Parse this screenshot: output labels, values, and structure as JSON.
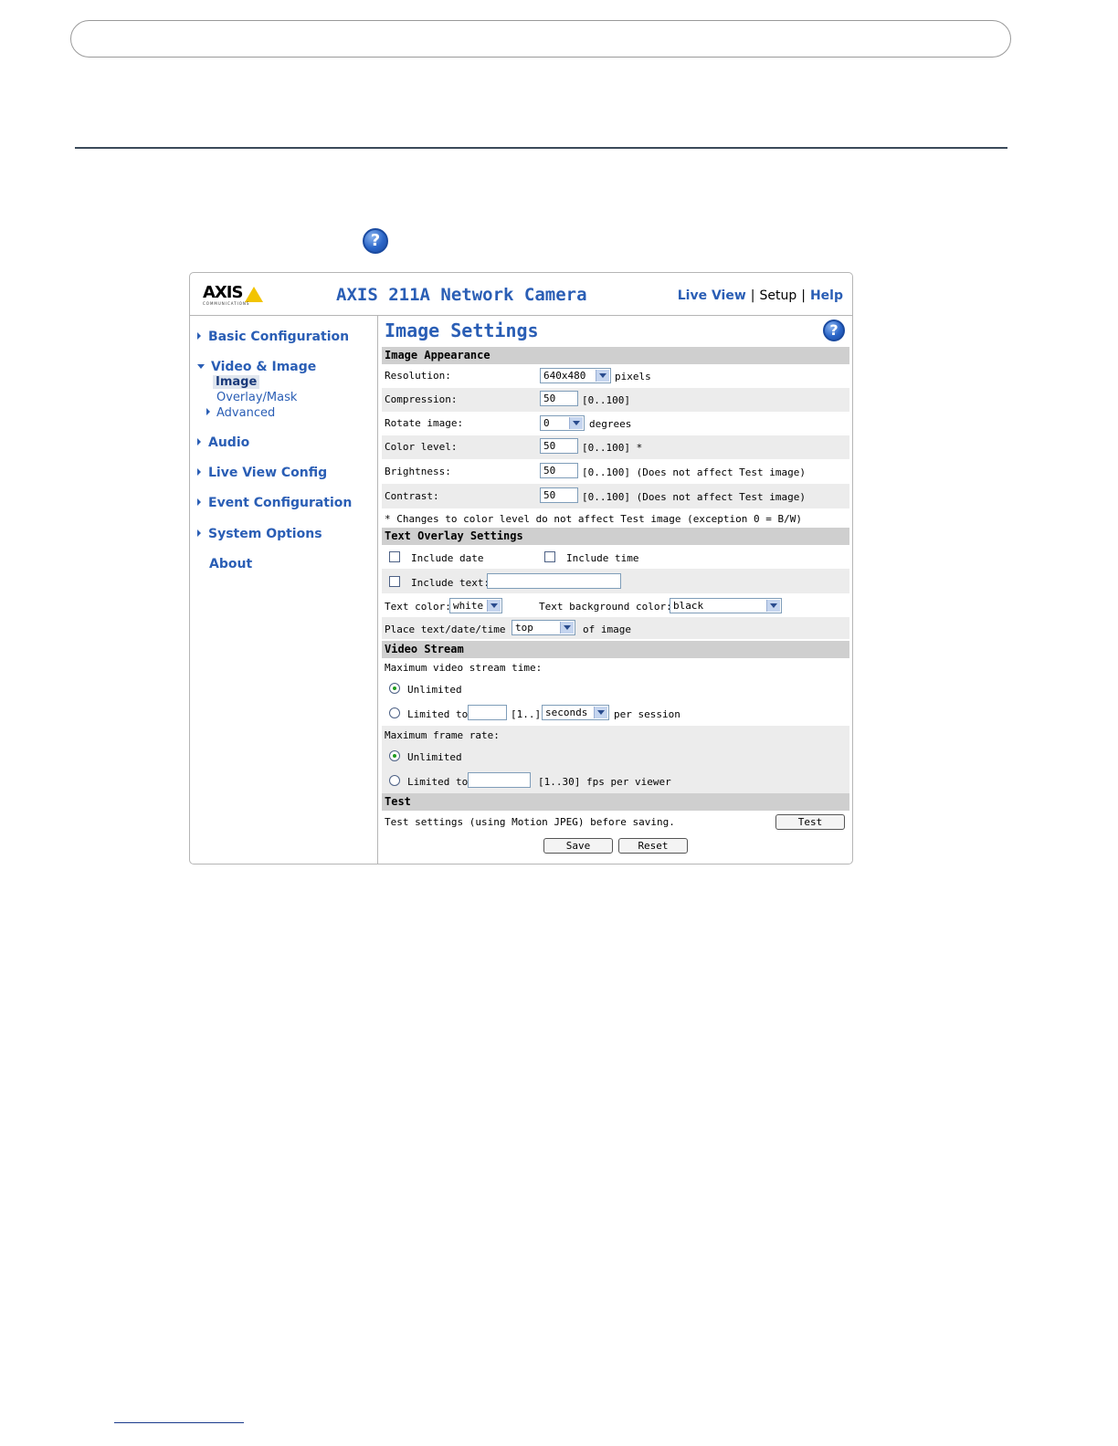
{
  "header": {
    "logo_text": "AXIS",
    "logo_subtext": "COMMUNICATIONS",
    "camera_title": "AXIS 211A Network Camera",
    "links": {
      "live_view": "Live View",
      "setup": "Setup",
      "help": "Help"
    },
    "link_separator": "|"
  },
  "sidebar": {
    "basic_configuration": "Basic Configuration",
    "video_image": "Video & Image",
    "image": "Image",
    "overlay_mask": "Overlay/Mask",
    "advanced": "Advanced",
    "audio": "Audio",
    "live_view_config": "Live View Config",
    "event_configuration": "Event Configuration",
    "system_options": "System Options",
    "about": "About"
  },
  "page": {
    "title": "Image Settings",
    "help_glyph": "?"
  },
  "image_appearance": {
    "heading": "Image Appearance",
    "resolution_label": "Resolution:",
    "resolution_value": "640x480",
    "resolution_unit": "pixels",
    "compression_label": "Compression:",
    "compression_value": "50",
    "compression_range": "[0..100]",
    "rotate_label": "Rotate image:",
    "rotate_value": "0",
    "rotate_unit": "degrees",
    "color_label": "Color level:",
    "color_value": "50",
    "color_range": "[0..100] *",
    "brightness_label": "Brightness:",
    "brightness_value": "50",
    "brightness_range": "[0..100] (Does not affect Test image)",
    "contrast_label": "Contrast:",
    "contrast_value": "50",
    "contrast_range": "[0..100] (Does not affect Test image)",
    "footnote": "* Changes to color level do not affect Test image (exception 0 = B/W)"
  },
  "text_overlay": {
    "heading": "Text Overlay Settings",
    "include_date": "Include date",
    "include_time": "Include time",
    "include_text": "Include text:",
    "include_text_value": "",
    "text_color_label": "Text color:",
    "text_color_value": "white",
    "bg_color_label": "Text background color:",
    "bg_color_value": "black",
    "place_label": "Place text/date/time at",
    "place_value": "top",
    "place_suffix": "of image"
  },
  "video_stream": {
    "heading": "Video Stream",
    "max_time_label": "Maximum video stream time:",
    "unlimited_1": "Unlimited",
    "limited_to_1": "Limited to",
    "limited_value_1": "",
    "limited_range_1": "[1..]",
    "unit_value": "seconds",
    "per_session": "per session",
    "max_frame_label": "Maximum frame rate:",
    "unlimited_2": "Unlimited",
    "limited_to_2": "Limited to",
    "limited_value_2": "",
    "fps_range": "[1..30] fps per viewer"
  },
  "test": {
    "heading": "Test",
    "description": "Test settings (using Motion JPEG) before saving.",
    "test_button": "Test",
    "save_button": "Save",
    "reset_button": "Reset"
  }
}
